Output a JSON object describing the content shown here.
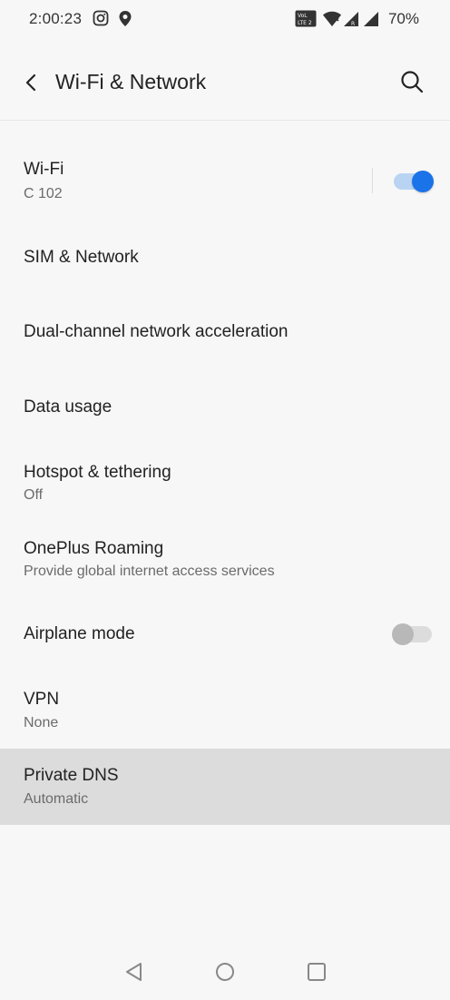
{
  "status_bar": {
    "time": "2:00:23",
    "battery": "70%",
    "network_badge": "VoLTE 2"
  },
  "header": {
    "title": "Wi-Fi & Network"
  },
  "items": [
    {
      "title": "Wi-Fi",
      "subtitle": "C 102",
      "toggle": true
    },
    {
      "title": "SIM & Network",
      "subtitle": ""
    },
    {
      "title": "Dual-channel network acceleration",
      "subtitle": ""
    },
    {
      "title": "Data usage",
      "subtitle": ""
    },
    {
      "title": "Hotspot & tethering",
      "subtitle": "Off"
    },
    {
      "title": "OnePlus Roaming",
      "subtitle": "Provide global internet access services"
    },
    {
      "title": "Airplane mode",
      "subtitle": "",
      "toggle": false
    },
    {
      "title": "VPN",
      "subtitle": "None"
    },
    {
      "title": "Private DNS",
      "subtitle": "Automatic",
      "highlighted": true
    }
  ],
  "colors": {
    "accent": "#1a73e8",
    "background": "#f7f7f7",
    "highlight": "#dcdcdc"
  },
  "icons": [
    "instagram-icon",
    "location-icon",
    "volte-icon",
    "wifi-icon",
    "signal-icon",
    "back-arrow-icon",
    "search-icon",
    "nav-back-icon",
    "nav-home-icon",
    "nav-recents-icon"
  ]
}
